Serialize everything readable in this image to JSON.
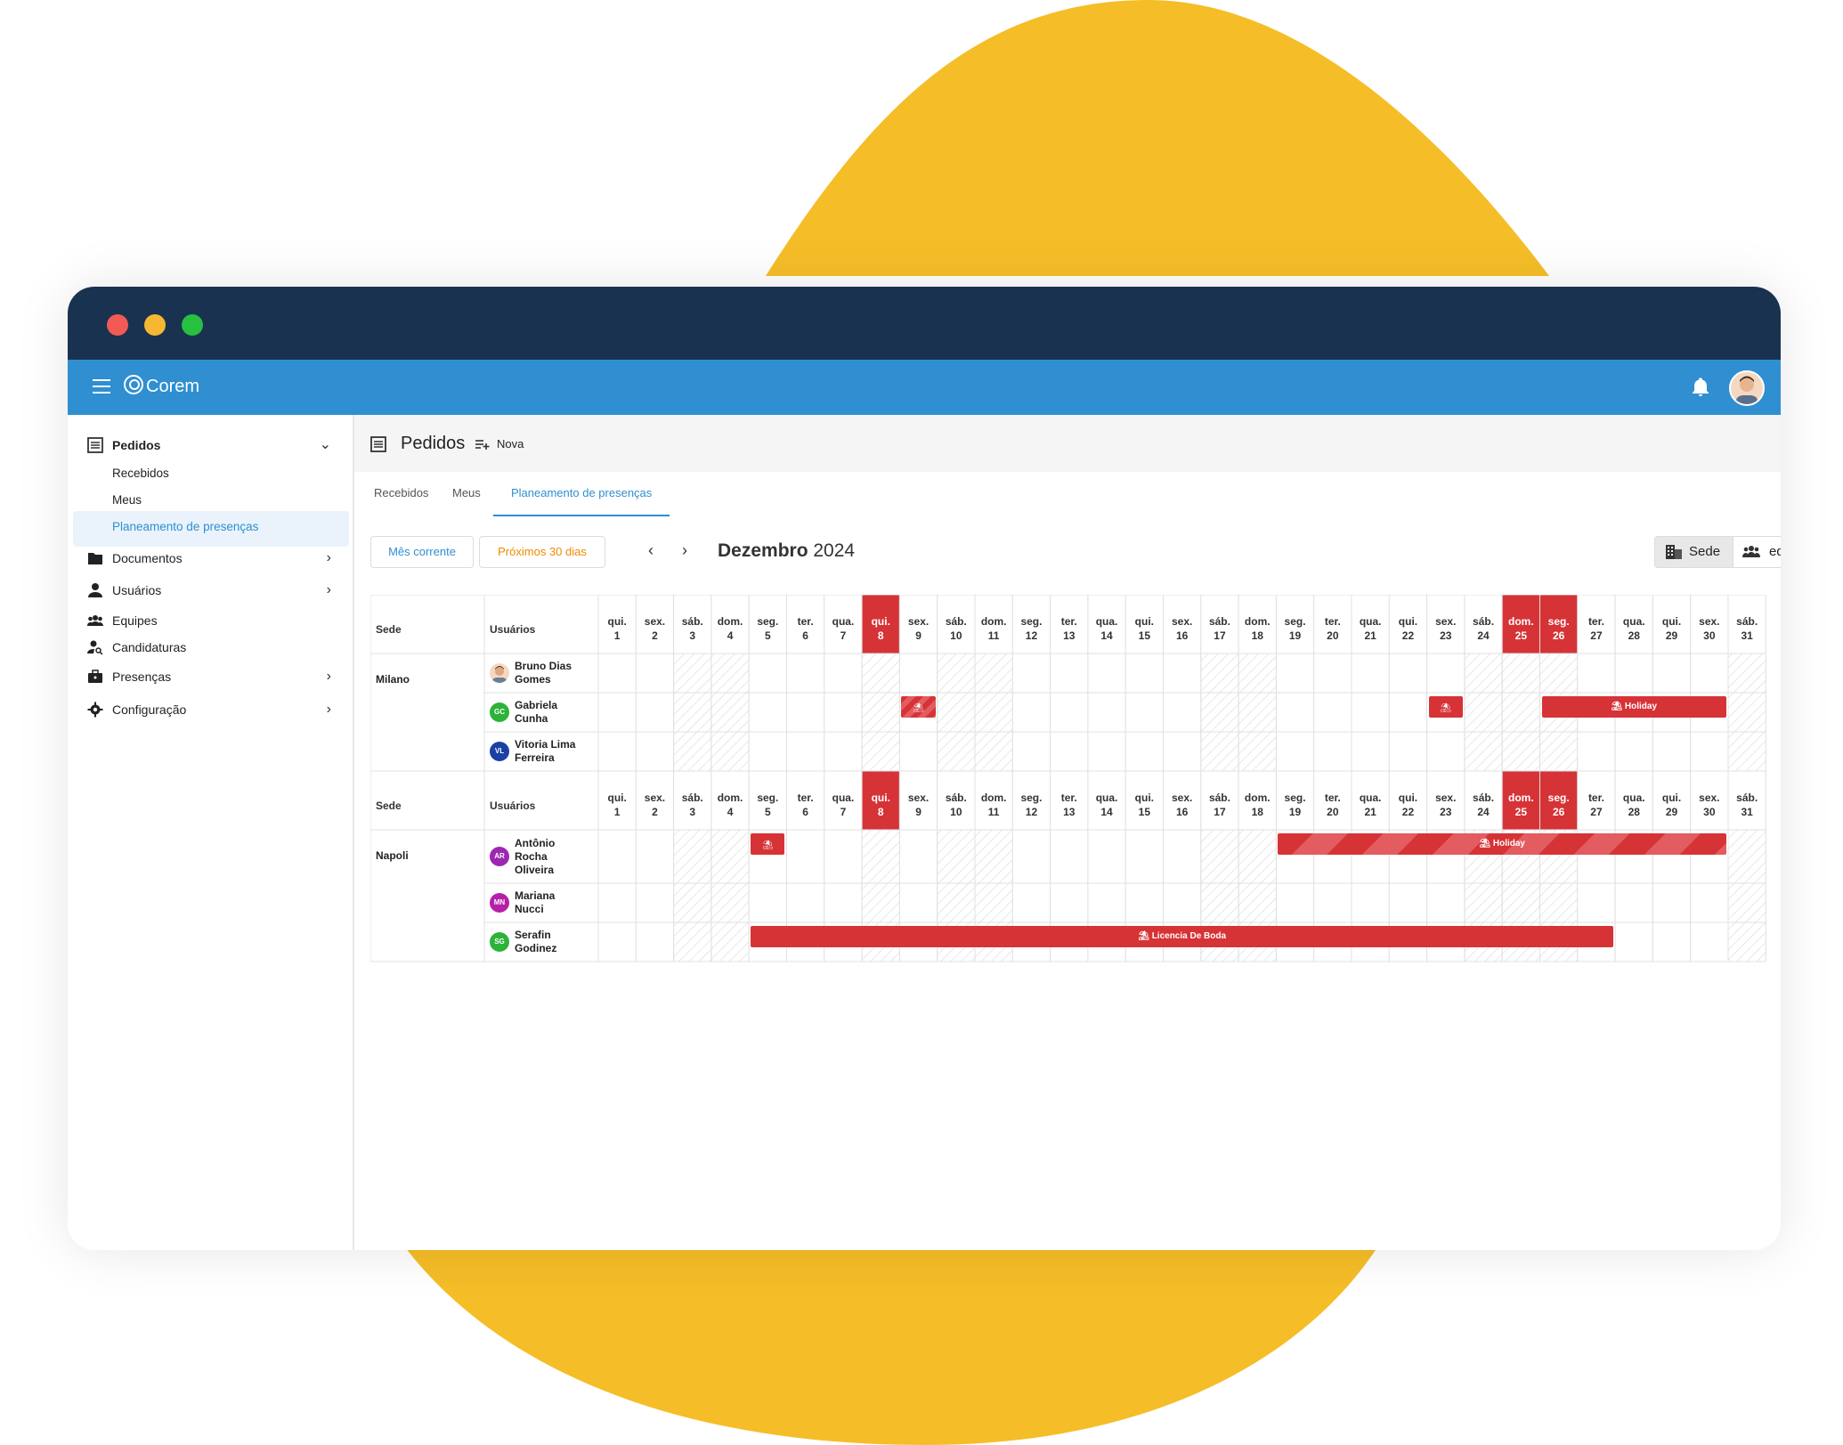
{
  "app": {
    "logo": "Corem"
  },
  "sidebar": {
    "items": [
      {
        "label": "Pedidos",
        "icon": "list-icon",
        "expanded": true,
        "sub": [
          "Recebidos",
          "Meus",
          "Planeamento de presenças"
        ]
      },
      {
        "label": "Documentos",
        "icon": "folder-icon"
      },
      {
        "label": "Usuários",
        "icon": "person-icon"
      },
      {
        "label": "Equipes",
        "icon": "group-icon"
      },
      {
        "label": "Candidaturas",
        "icon": "person-search-icon"
      },
      {
        "label": "Presenças",
        "icon": "briefcase-icon"
      },
      {
        "label": "Configuração",
        "icon": "gear-icon"
      }
    ],
    "active_sub": "Planeamento de presenças"
  },
  "header": {
    "title": "Pedidos",
    "new_label": "Nova"
  },
  "tabs": [
    "Recebidos",
    "Meus",
    "Planeamento de presenças"
  ],
  "active_tab": "Planeamento de presenças",
  "filters": {
    "current_month": "Mês corrente",
    "next_30": "Próximos 30 dias"
  },
  "month": {
    "name": "Dezembro",
    "year": "2024"
  },
  "view_toggle": {
    "sede": "Sede",
    "equipe": "equipe"
  },
  "calendar": {
    "col_sede": "Sede",
    "col_users": "Usuários",
    "days": [
      [
        "qui.",
        "1"
      ],
      [
        "sex.",
        "2"
      ],
      [
        "sáb.",
        "3"
      ],
      [
        "dom.",
        "4"
      ],
      [
        "seg.",
        "5"
      ],
      [
        "ter.",
        "6"
      ],
      [
        "qua.",
        "7"
      ],
      [
        "qui.",
        "8"
      ],
      [
        "sex.",
        "9"
      ],
      [
        "sáb.",
        "10"
      ],
      [
        "dom.",
        "11"
      ],
      [
        "seg.",
        "12"
      ],
      [
        "ter.",
        "13"
      ],
      [
        "qua.",
        "14"
      ],
      [
        "qui.",
        "15"
      ],
      [
        "sex.",
        "16"
      ],
      [
        "sáb.",
        "17"
      ],
      [
        "dom.",
        "18"
      ],
      [
        "seg.",
        "19"
      ],
      [
        "ter.",
        "20"
      ],
      [
        "qua.",
        "21"
      ],
      [
        "qui.",
        "22"
      ],
      [
        "sex.",
        "23"
      ],
      [
        "sáb.",
        "24"
      ],
      [
        "dom.",
        "25"
      ],
      [
        "seg.",
        "26"
      ],
      [
        "ter.",
        "27"
      ],
      [
        "qua.",
        "28"
      ],
      [
        "qui.",
        "29"
      ],
      [
        "sex.",
        "30"
      ],
      [
        "sáb.",
        "31"
      ]
    ],
    "highlighted_days": [
      8,
      25,
      26
    ],
    "hatched_days": [
      3,
      4,
      8,
      10,
      11,
      17,
      18,
      24,
      25,
      26,
      31
    ],
    "groups": [
      {
        "site": "Milano",
        "users": [
          {
            "name_lines": [
              "Bruno Dias",
              "Gomes"
            ],
            "initials": "",
            "color": "#f3d9c2",
            "photo": true
          },
          {
            "name_lines": [
              "Gabriela",
              "Cunha"
            ],
            "initials": "GC",
            "color": "#2db33a"
          },
          {
            "name_lines": [
              "Vitoria Lima",
              "Ferreira"
            ],
            "initials": "VL",
            "color": "#1b3fa3"
          }
        ],
        "absences": [
          {
            "user": 1,
            "start": 9,
            "end": 9,
            "label": "",
            "striped": true
          },
          {
            "user": 1,
            "start": 23,
            "end": 23,
            "label": "",
            "striped": false
          },
          {
            "user": 1,
            "start": 26,
            "end": 30,
            "label": "Holiday",
            "striped": false
          }
        ]
      },
      {
        "site": "Napoli",
        "users": [
          {
            "name_lines": [
              "Antônio",
              "Rocha",
              "Oliveira"
            ],
            "initials": "AR",
            "color": "#9c27b0"
          },
          {
            "name_lines": [
              "Mariana",
              "Nucci"
            ],
            "initials": "MN",
            "color": "#b620a8"
          },
          {
            "name_lines": [
              "Serafin",
              "Godinez"
            ],
            "initials": "SG",
            "color": "#2db33a"
          }
        ],
        "absences": [
          {
            "user": 0,
            "start": 5,
            "end": 5,
            "label": "",
            "striped": false
          },
          {
            "user": 0,
            "start": 19,
            "end": 30,
            "label": "Holiday",
            "striped": true
          },
          {
            "user": 2,
            "start": 5,
            "end": 27,
            "label": "Licencia De Boda",
            "striped": false
          }
        ]
      }
    ]
  },
  "colors": {
    "appbar": "#2f8fd1",
    "titlebar": "#19324f",
    "accent_red": "#d63337",
    "blob": "#f5bd27",
    "orange_text": "#f08a00"
  }
}
